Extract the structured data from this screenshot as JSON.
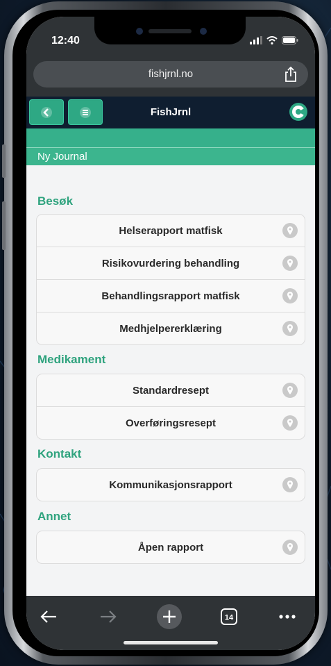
{
  "status": {
    "time": "12:40"
  },
  "browser": {
    "url": "fishjrnl.no",
    "tab_count": "14"
  },
  "app": {
    "brand": "FishJrnl",
    "page_title": "Ny Journal"
  },
  "sections": [
    {
      "title": "Besøk",
      "items": [
        "Helserapport matfisk",
        "Risikovurdering behandling",
        "Behandlingsrapport matfisk",
        "Medhjelpererklæring"
      ]
    },
    {
      "title": "Medikament",
      "items": [
        "Standardresept",
        "Overføringsresept"
      ]
    },
    {
      "title": "Kontakt",
      "items": [
        "Kommunikasjonsrapport"
      ]
    },
    {
      "title": "Annet",
      "items": [
        "Åpen rapport"
      ]
    }
  ],
  "colors": {
    "accent": "#36b08b",
    "header": "#0f1e30",
    "section_title": "#2fa37e"
  },
  "icons": [
    "back-arrow-icon",
    "menu-icon",
    "location-pin-icon",
    "share-icon",
    "plus-icon",
    "tabs-icon",
    "more-icon",
    "forward-arrow-icon"
  ]
}
